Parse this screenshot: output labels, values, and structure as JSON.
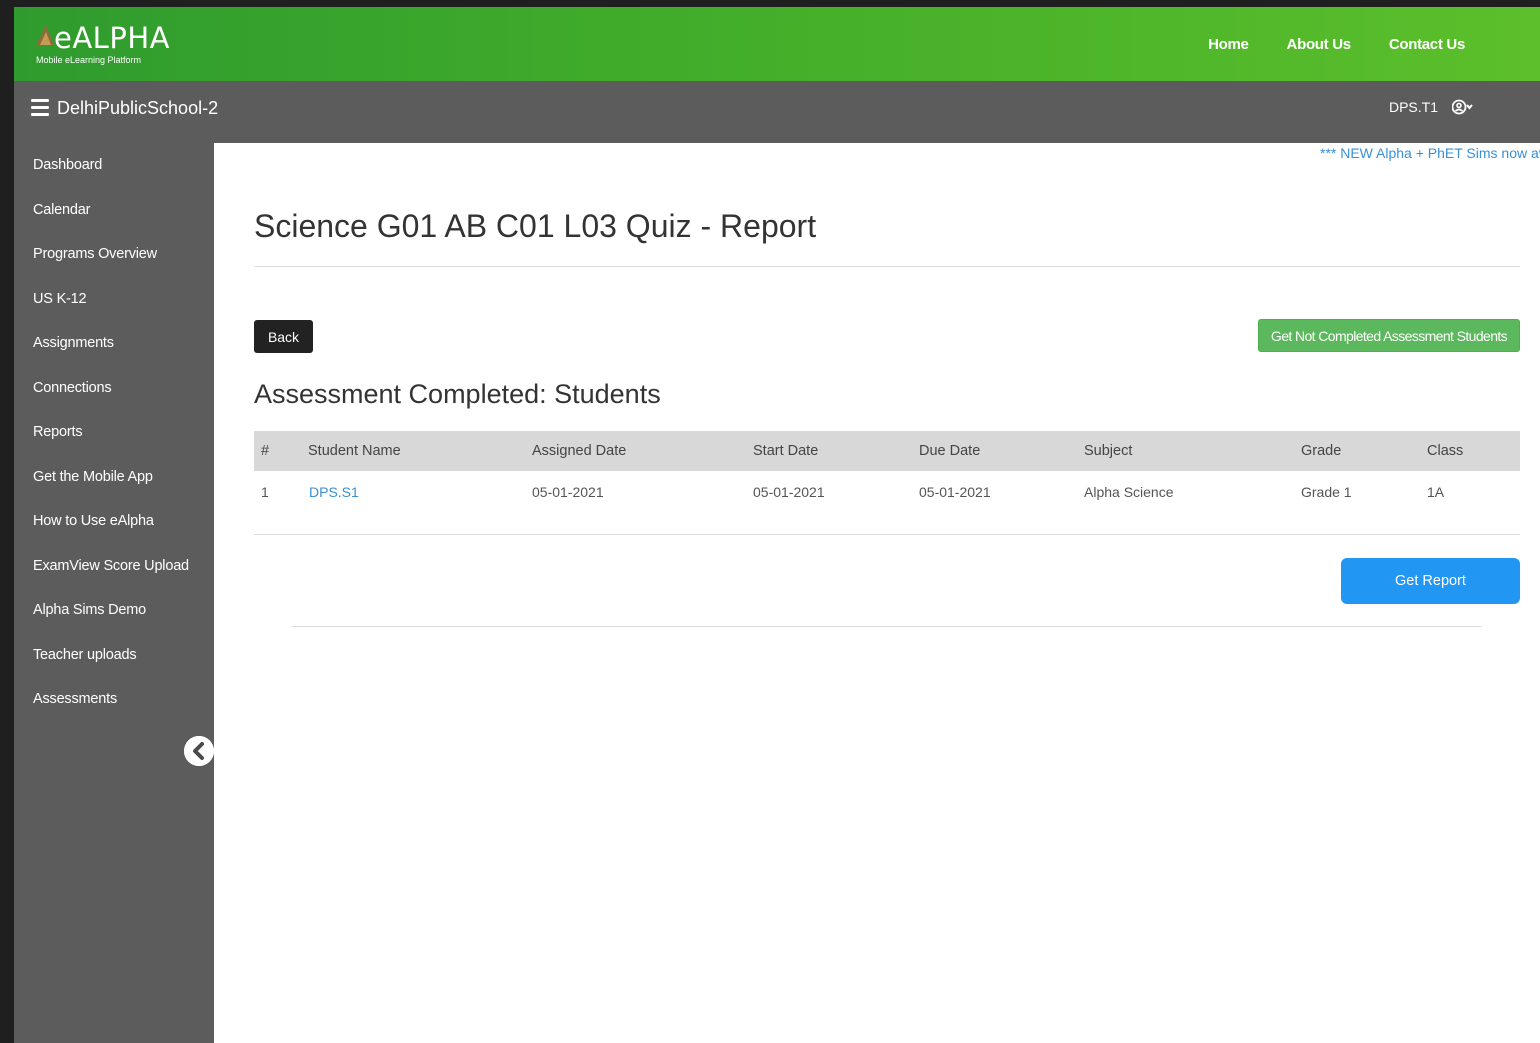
{
  "brand": {
    "name": "eALPHA",
    "tagline": "Mobile eLearning Platform"
  },
  "topnav": [
    "Home",
    "About Us",
    "Contact Us"
  ],
  "header": {
    "school": "DelhiPublicSchool-2",
    "user": "DPS.T1"
  },
  "sidebar": {
    "items": [
      "Dashboard",
      "Calendar",
      "Programs Overview",
      "US K-12",
      "Assignments",
      "Connections",
      "Reports",
      "Get the Mobile App",
      "How to Use eAlpha",
      "ExamView Score Upload",
      "Alpha Sims Demo",
      "Teacher uploads",
      "Assessments"
    ]
  },
  "marquee": "*** NEW Alpha + PhET Sims now av",
  "page": {
    "title": "Science G01 AB C01 L03 Quiz - Report",
    "back_label": "Back",
    "not_completed_label": "Get Not Completed Assessment Students",
    "section_title": "Assessment Completed: Students",
    "get_report_label": "Get Report"
  },
  "table": {
    "columns": [
      "#",
      "Student Name",
      "Assigned Date",
      "Start Date",
      "Due Date",
      "Subject",
      "Grade",
      "Class"
    ],
    "rows": [
      [
        "1",
        "DPS.S1",
        "05-01-2021",
        "05-01-2021",
        "05-01-2021",
        "Alpha Science",
        "Grade 1",
        "1A"
      ]
    ]
  },
  "colors": {
    "topbar_green": "#42ad2a",
    "header_gray": "#5c5c5c",
    "accent_blue": "#2196f3",
    "success_green": "#5cb85c"
  }
}
